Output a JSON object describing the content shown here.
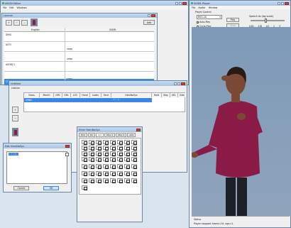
{
  "eSign_editor": {
    "title": "eSIGN Editor",
    "menu": [
      "File",
      "Edit",
      "Windows"
    ],
    "small_title": "Lexicon",
    "toolbar_button": "Add",
    "columns": [
      "English",
      "SiGML"
    ],
    "rows": [
      {
        "english": "DRIG",
        "sigml": "",
        "selected": false
      },
      {
        "english": "ALTO",
        "sigml": "SPND",
        "selected": false
      },
      {
        "english": "",
        "sigml": "SPND",
        "selected": false
      },
      {
        "english": "AVOID 1",
        "sigml": "",
        "selected": false
      },
      {
        "english": "",
        "sigml": "SPND",
        "selected": false
      },
      {
        "english": "COME-TO",
        "sigml": "SPND",
        "selected": true
      }
    ]
  },
  "sign_window": {
    "title": "Untitled",
    "subtitle": "Lexicon",
    "columns": [
      "Gloss",
      "Mouth",
      "GRC",
      "GRL",
      "LOC",
      "Hand",
      "Looks",
      "Face",
      "HamNoSys",
      "Hold",
      "Stay",
      "UEL",
      "Side"
    ],
    "row": {
      "gloss": "SPND",
      "hamnosys": "ᚠᛏᛁ ᛒᚲ"
    }
  },
  "hamnosys_editor": {
    "title": "Edit HamNoSys",
    "value": "ᚠᛏᛁ ᛒᚲ",
    "cancel_label": "Cancel",
    "ok_label": "OK"
  },
  "enter_hamnosys": {
    "title": "Enter HamNoSys",
    "tabs": [
      "Hsh",
      "Ori",
      "Loc",
      "Mov 1",
      "Mov 2",
      "Ahd"
    ]
  },
  "player": {
    "title": "SiGML Player",
    "menu": [
      "File",
      "Avatar",
      "Window"
    ],
    "panel_title": "Player Control",
    "avatar_select": "BSG-2A",
    "play_label": "Play",
    "stop_label": "Stop",
    "checkboxes": [
      {
        "label": "Auto-Play",
        "checked": true
      },
      {
        "label": "Cycle-Play",
        "checked": false
      },
      {
        "label": "Single Sign",
        "checked": false
      }
    ],
    "speed_label": "Speech ds (log scale)",
    "readouts": [
      "LOD",
      "1/8",
      "LG",
      "1",
      "3"
    ],
    "status_title": "Status",
    "status_text": "Player stopped: frame=19, sign=1."
  },
  "colors": {
    "selection": "#3a87e6",
    "avatar_shirt": "#8a1a46",
    "avatar_bg": "#8499b2"
  }
}
